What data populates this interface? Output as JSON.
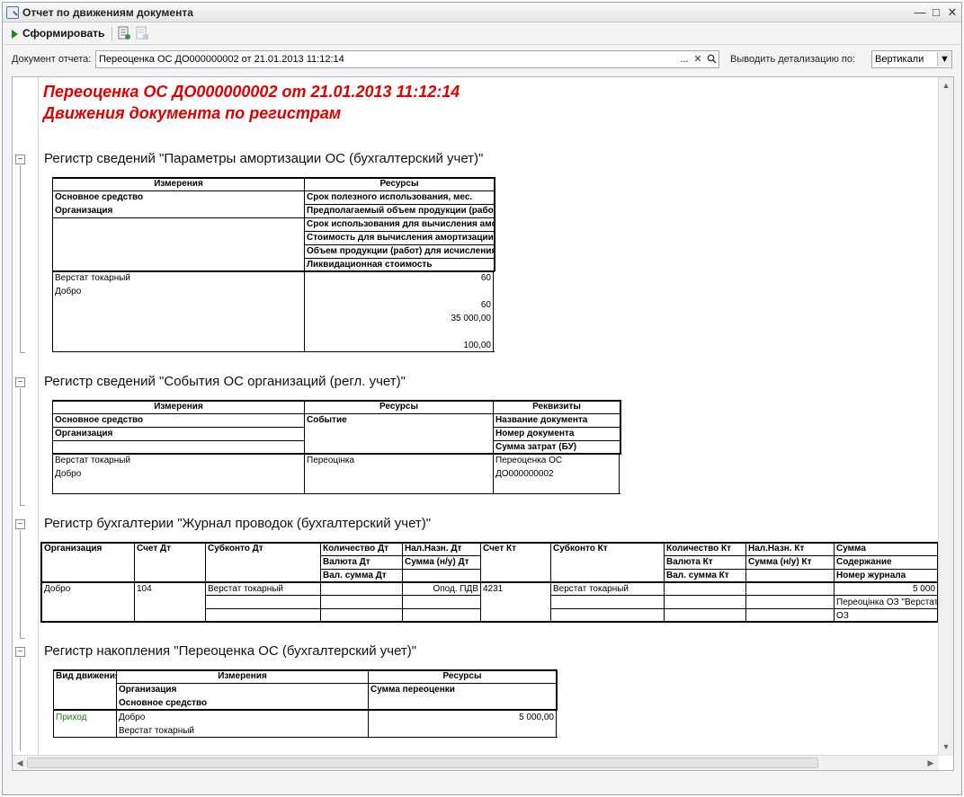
{
  "window": {
    "title": "Отчет по движениям документа"
  },
  "toolbar": {
    "generate_label": "Сформировать"
  },
  "filters": {
    "doc_label": "Документ отчета:",
    "doc_value": "Переоценка ОС ДО000000002 от 21.01.2013 11:12:14",
    "detail_label": "Выводить детализацию по:",
    "detail_value": "Вертикали",
    "pick_btn": "...",
    "clear_btn": "✕"
  },
  "report": {
    "title1": "Переоценка ОС ДО000000002 от 21.01.2013 11:12:14",
    "title2": "Движения документа по регистрам",
    "reg1": {
      "title": "Регистр сведений \"Параметры амортизации ОС (бухгалтерский учет)\"",
      "hdr_dims": "Измерения",
      "hdr_res": "Ресурсы",
      "dims": [
        "Основное средство",
        "Организация"
      ],
      "res": [
        "Срок полезного использования, мес.",
        "Предполагаемый объем продукции (работ)",
        "Срок использования для вычисления амортизации",
        "Стоимость для вычисления амортизации",
        "Объем продукции (работ) для исчисления амортизации",
        "Ликвидационная стоимость"
      ],
      "row_dims": [
        "Верстат токарный",
        "Добро"
      ],
      "row_res": [
        "60",
        "",
        "60",
        "35 000,00",
        "",
        "100,00"
      ]
    },
    "reg2": {
      "title": "Регистр сведений \"События ОС организаций (регл. учет)\"",
      "hdr_dims": "Измерения",
      "hdr_res": "Ресурсы",
      "hdr_req": "Реквизиты",
      "dims": [
        "Основное средство",
        "Организация"
      ],
      "res": [
        "Событие"
      ],
      "req": [
        "Название документа",
        "Номер документа",
        "Сумма затрат (БУ)"
      ],
      "row_dims": [
        "Верстат токарный",
        "Добро"
      ],
      "row_res": "Переоцінка",
      "row_req": [
        "Переоценка ОС",
        "ДО000000002"
      ]
    },
    "reg3": {
      "title": "Регистр бухгалтерии \"Журнал проводок (бухгалтерский учет)\"",
      "headers": {
        "org": "Организация",
        "acc_dt": "Счет Дт",
        "sub_dt": "Субконто Дт",
        "qty_dt": "Количество Дт",
        "cur_dt": "Валюта Дт",
        "valsum_dt": "Вал. сумма Дт",
        "tax_dt": "Нал.Назн. Дт",
        "sum_nu_dt": "Сумма (н/у) Дт",
        "acc_kt": "Счет Кт",
        "sub_kt": "Субконто Кт",
        "qty_kt": "Количество Кт",
        "cur_kt": "Валюта Кт",
        "valsum_kt": "Вал. сумма Кт",
        "tax_kt": "Нал.Назн. Кт",
        "sum_nu_kt": "Сумма (н/у) Кт",
        "sum": "Сумма",
        "content": "Содержание",
        "journal": "Номер журнала"
      },
      "row": {
        "org": "Добро",
        "acc_dt": "104",
        "sub_dt": "Верстат токарный",
        "tax_dt": "Опод. ПДВ",
        "acc_kt": "4231",
        "sub_kt": "Верстат токарный",
        "sum": "5 000",
        "content": "Переоцінка ОЗ \"Верстат токарный\"",
        "journal": "ОЗ"
      }
    },
    "reg4": {
      "title": "Регистр накопления \"Переоценка ОС (бухгалтерский учет)\"",
      "hdr_kind": "Вид движения",
      "hdr_dims": "Измерения",
      "hdr_res": "Ресурсы",
      "dims": [
        "Организация",
        "Основное средство"
      ],
      "res": [
        "Сумма переоценки"
      ],
      "row_kind": "Приход",
      "row_dims": [
        "Добро",
        "Верстат токарный"
      ],
      "row_sum": "5 000,00"
    }
  }
}
